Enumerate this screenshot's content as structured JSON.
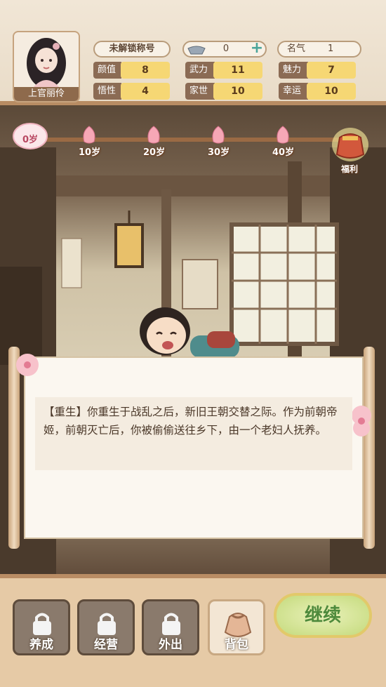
{
  "player": {
    "name": "上官丽伶"
  },
  "title_badge": "未解锁称号",
  "currency": {
    "value": "0"
  },
  "fame": {
    "label": "名气",
    "value": "1"
  },
  "stats": [
    {
      "label": "颜值",
      "value": "8"
    },
    {
      "label": "武力",
      "value": "11"
    },
    {
      "label": "魅力",
      "value": "7"
    },
    {
      "label": "悟性",
      "value": "4"
    },
    {
      "label": "家世",
      "value": "10"
    },
    {
      "label": "幸运",
      "value": "10"
    }
  ],
  "timeline": {
    "current": "0岁",
    "milestones": [
      "10岁",
      "20岁",
      "30岁",
      "40岁"
    ],
    "reward_label": "福利"
  },
  "story": {
    "text": "【重生】你重生于战乱之后，新旧王朝交替之际。作为前朝帝姬，前朝灭亡后，你被偷偷送往乡下，由一个老妇人抚养。"
  },
  "nav": [
    {
      "label": "养成",
      "locked": true
    },
    {
      "label": "经营",
      "locked": true
    },
    {
      "label": "外出",
      "locked": true
    },
    {
      "label": "背包",
      "locked": false
    }
  ],
  "continue_label": "继续",
  "colors": {
    "accent": "#f6d774",
    "continue": "#4e8a3c"
  }
}
